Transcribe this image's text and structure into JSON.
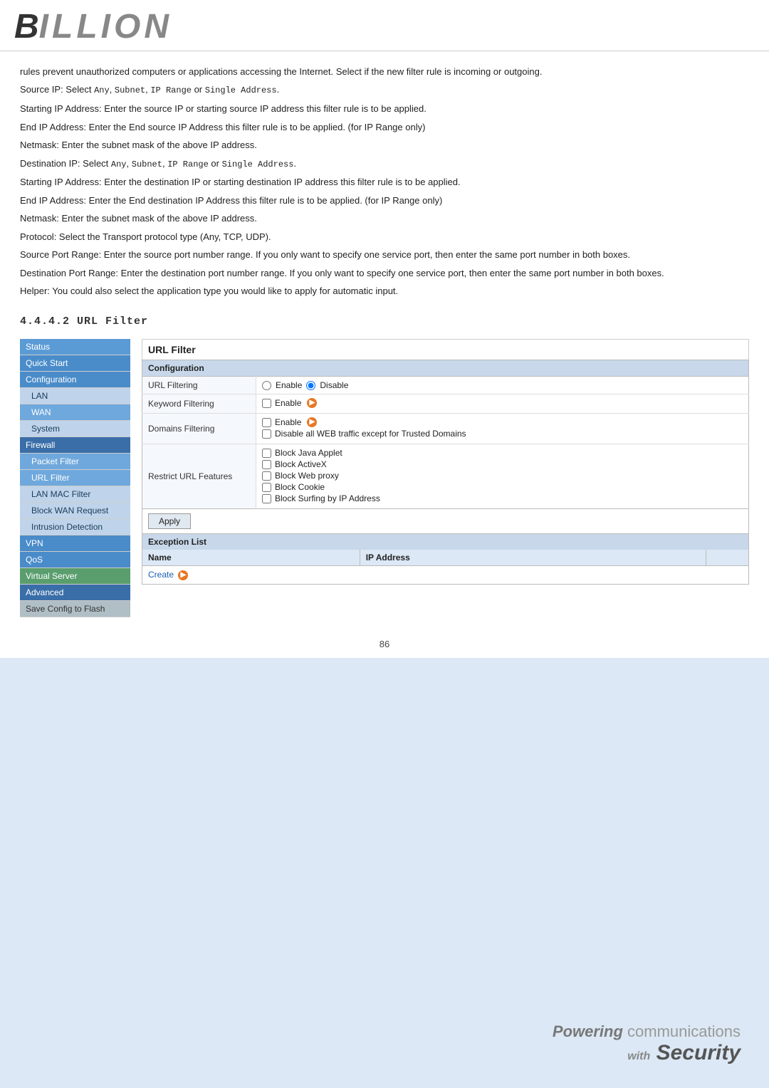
{
  "logo": {
    "text": "BILLION"
  },
  "body_paragraphs": [
    "rules prevent unauthorized computers or applications accessing the Internet. Select if the new filter rule is incoming or outgoing.",
    "Source IP: Select Any, Subnet, IP Range or Single Address.",
    "Starting IP Address: Enter the source IP or starting source IP address this filter rule is to be applied.",
    "End IP Address: Enter the End source IP Address this filter rule is to be applied. (for IP Range only)",
    "Netmask: Enter the subnet mask of the above IP address.",
    "Destination IP: Select Any, Subnet, IP Range or Single Address.",
    "Starting IP Address: Enter the destination IP or starting destination IP address this filter rule is to be applied.",
    "End IP Address: Enter the End destination IP Address this filter rule is to be applied. (for IP Range only)",
    "Netmask: Enter the subnet mask of the above IP address.",
    "Protocol: Select the Transport protocol type (Any, TCP, UDP).",
    "Source Port Range: Enter the source port number range. If you only want to specify one service port, then enter the same port number in both boxes.",
    "Destination Port Range: Enter the destination port number range. If you only want to specify one service port, then enter the same port number in both boxes.",
    "Helper: You could also select the application type you would like to apply for automatic input."
  ],
  "section_heading": "4.4.4.2  URL Filter",
  "sidebar": {
    "items": [
      {
        "label": "Status",
        "style": "active"
      },
      {
        "label": "Quick Start",
        "style": "highlight"
      },
      {
        "label": "Configuration",
        "style": "highlight"
      },
      {
        "label": "LAN",
        "style": "sub"
      },
      {
        "label": "WAN",
        "style": "sub active-sub"
      },
      {
        "label": "System",
        "style": "sub"
      },
      {
        "label": "Firewall",
        "style": "dark"
      },
      {
        "label": "Packet Filter",
        "style": "sub active-sub"
      },
      {
        "label": "URL Filter",
        "style": "sub active-sub"
      },
      {
        "label": "LAN MAC Filter",
        "style": "sub"
      },
      {
        "label": "Block WAN Request",
        "style": "sub"
      },
      {
        "label": "Intrusion Detection",
        "style": "sub"
      },
      {
        "label": "VPN",
        "style": "highlight"
      },
      {
        "label": "QoS",
        "style": "highlight"
      },
      {
        "label": "Virtual Server",
        "style": "green"
      },
      {
        "label": "Advanced",
        "style": "dark2"
      },
      {
        "label": "Save Config to Flash",
        "style": "gray"
      }
    ]
  },
  "url_filter": {
    "title": "URL Filter",
    "configuration_label": "Configuration",
    "rows": [
      {
        "label": "URL Filtering",
        "type": "radio",
        "options": [
          "Enable",
          "Disable"
        ],
        "selected": "Disable"
      },
      {
        "label": "Keyword Filtering",
        "type": "checkbox_with_details",
        "checked": false,
        "text": "Enable",
        "has_details": true
      },
      {
        "label": "Domains Filtering",
        "type": "domains",
        "checkbox1_text": "Enable",
        "checkbox1_checked": false,
        "has_details": true,
        "checkbox2_text": "Disable all WEB traffic except for Trusted Domains",
        "checkbox2_checked": false
      }
    ],
    "restrict_label": "Restrict URL Features",
    "restrict_options": [
      {
        "label": "Block Java Applet",
        "checked": false
      },
      {
        "label": "Block ActiveX",
        "checked": false
      },
      {
        "label": "Block Web proxy",
        "checked": false
      },
      {
        "label": "Block Cookie",
        "checked": false
      },
      {
        "label": "Block Surfing by IP Address",
        "checked": false
      }
    ],
    "apply_label": "Apply",
    "exception_list_label": "Exception List",
    "exception_columns": [
      "Name",
      "IP Address"
    ],
    "create_label": "Create"
  },
  "footer": {
    "page_number": "86",
    "branding_powering": "Powering",
    "branding_with": "with",
    "branding_security": "Security"
  }
}
